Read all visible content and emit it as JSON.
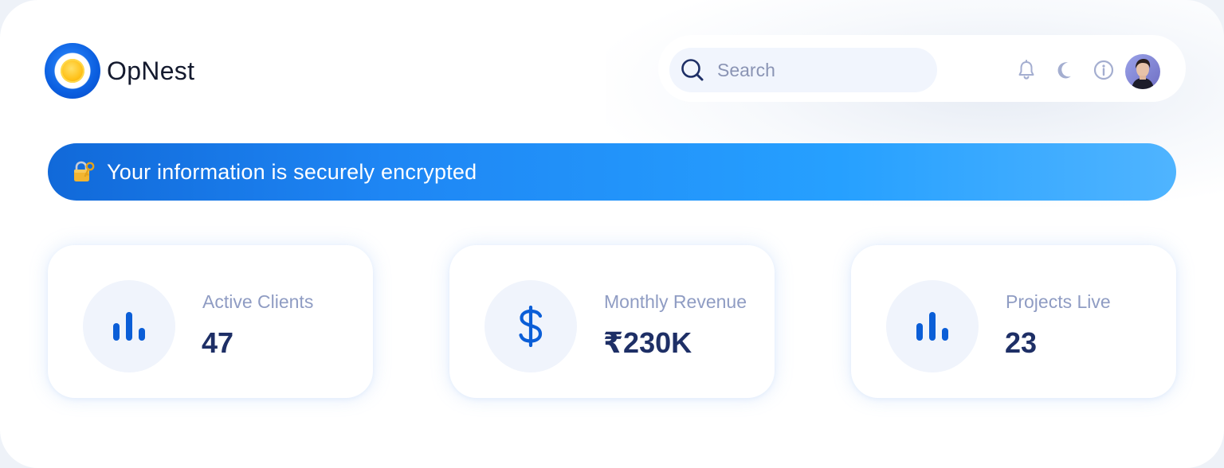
{
  "app": {
    "name": "OpNest"
  },
  "header": {
    "search": {
      "placeholder": "Search"
    },
    "icons": [
      "bell-icon",
      "moon-icon",
      "info-icon",
      "avatar"
    ]
  },
  "banner": {
    "icon": "lock-key-icon",
    "text": "Your information is securely encrypted"
  },
  "stats": [
    {
      "label": "Active Clients",
      "value": "47",
      "icon": "bar-chart-icon"
    },
    {
      "label": "Monthly Revenue",
      "value": "₹230K",
      "icon": "dollar-icon"
    },
    {
      "label": "Projects Live",
      "value": "23",
      "icon": "bar-chart-icon"
    }
  ],
  "colors": {
    "primary": "#0b5fe0",
    "banner_start": "#1169d9",
    "banner_end": "#4fb4ff",
    "value_text": "#1e2f66",
    "label_text": "#8f9cc3",
    "icon_accent": "#0b5ed7",
    "logo_yellow": "#ffc21a"
  }
}
